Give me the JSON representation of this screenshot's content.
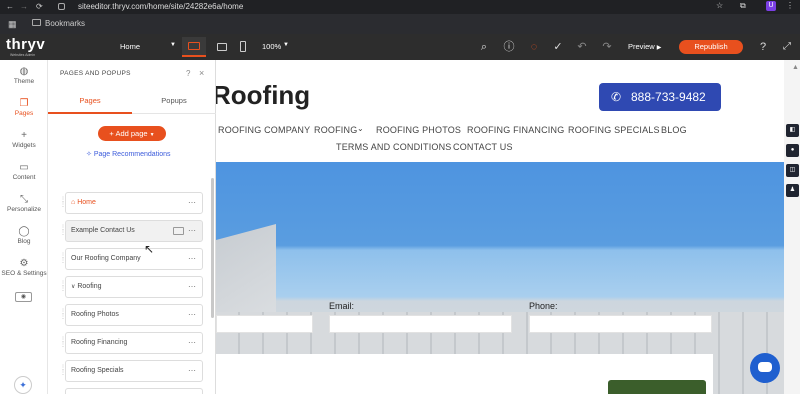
{
  "browser": {
    "url": "siteeditor.thryv.com/home/site/24282e6a/home",
    "bookmarks_label": "Bookmarks",
    "profile_initial": "U"
  },
  "toolbar": {
    "logo": "thryv",
    "logo_sub": "Websites Admin",
    "page_select": "Home",
    "zoom": "100%",
    "preview_label": "Preview",
    "republish_label": "Republish"
  },
  "rail": {
    "items": [
      {
        "label": "Theme",
        "icon": "palette-icon"
      },
      {
        "label": "Pages",
        "icon": "pages-icon"
      },
      {
        "label": "Widgets",
        "icon": "plus-icon"
      },
      {
        "label": "Content",
        "icon": "folder-icon"
      },
      {
        "label": "Personalize",
        "icon": "wand-icon"
      },
      {
        "label": "Blog",
        "icon": "chat-icon"
      },
      {
        "label": "SEO & Settings",
        "icon": "gear-icon"
      }
    ]
  },
  "panel": {
    "title": "PAGES AND POPUPS",
    "tab_pages": "Pages",
    "tab_popups": "Popups",
    "add_page_label": "+ Add page",
    "recommendations_label": "Page Recommendations",
    "pages": [
      "Home",
      "Example Contact Us",
      "Our Roofing Company",
      "Roofing",
      "Roofing Photos",
      "Roofing Financing",
      "Roofing Specials"
    ]
  },
  "site": {
    "brand_title": "Roofing",
    "phone": "888-733-9482",
    "nav_row1": [
      "ROOFING COMPANY",
      "ROOFING",
      "ROOFING PHOTOS",
      "ROOFING FINANCING",
      "ROOFING SPECIALS",
      "BLOG"
    ],
    "nav_row2": [
      "TERMS AND CONDITIONS",
      "CONTACT US"
    ],
    "email_label": "Email:",
    "phone_label": "Phone:"
  },
  "colors": {
    "accent": "#e8501e",
    "phone_button": "#2f49b2",
    "sky": "#5a9de0",
    "chat_bubble": "#1f5fcf"
  }
}
